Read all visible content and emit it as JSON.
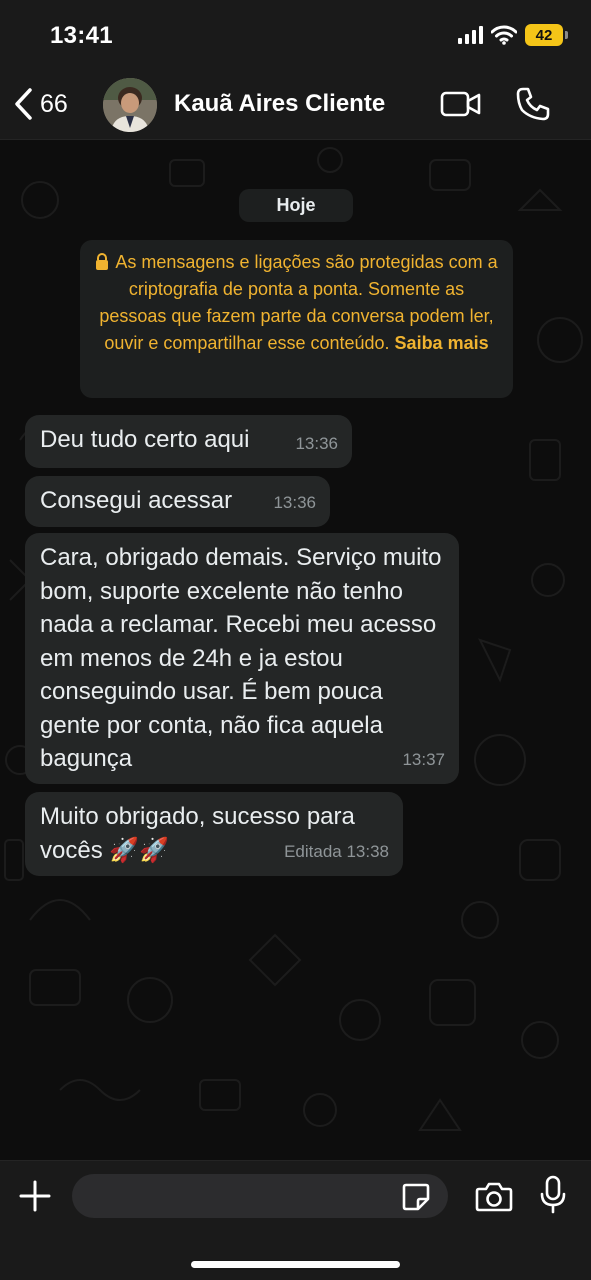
{
  "status_bar": {
    "time": "13:41",
    "battery_level": "42",
    "icons": [
      "signal-icon",
      "wifi-icon",
      "battery-icon"
    ]
  },
  "header": {
    "back_count": "66",
    "contact_name": "Kauã Aires Cliente",
    "icons": [
      "chevron-left-icon",
      "video-call-icon",
      "phone-icon"
    ]
  },
  "chat": {
    "date_label": "Hoje",
    "encryption_notice": {
      "text": "As mensagens e ligações são protegidas com a criptografia de ponta a ponta. Somente as pessoas que fazem parte da conversa podem ler, ouvir e compartilhar esse conteúdo.",
      "learn_more": "Saiba mais"
    },
    "messages": [
      {
        "text": "Deu tudo certo aqui",
        "time": "13:36"
      },
      {
        "text": "Consegui acessar",
        "time": "13:36"
      },
      {
        "text": "Cara, obrigado demais. Serviço muito bom, suporte excelente não tenho nada a reclamar. Recebi meu acesso em menos de 24h e ja estou conseguindo usar. É bem pouca gente por conta, não fica aquela bagunça",
        "time": "13:37"
      },
      {
        "text": "Muito obrigado, sucesso para vocês 🚀🚀",
        "time": "Editada 13:38"
      }
    ]
  },
  "composer": {
    "input_value": "",
    "icons": [
      "plus-icon",
      "sticker-icon",
      "camera-icon",
      "microphone-icon"
    ]
  },
  "colors": {
    "accent_notice": "#f0b330",
    "bubble": "#242626",
    "background": "#0d0d0d"
  }
}
